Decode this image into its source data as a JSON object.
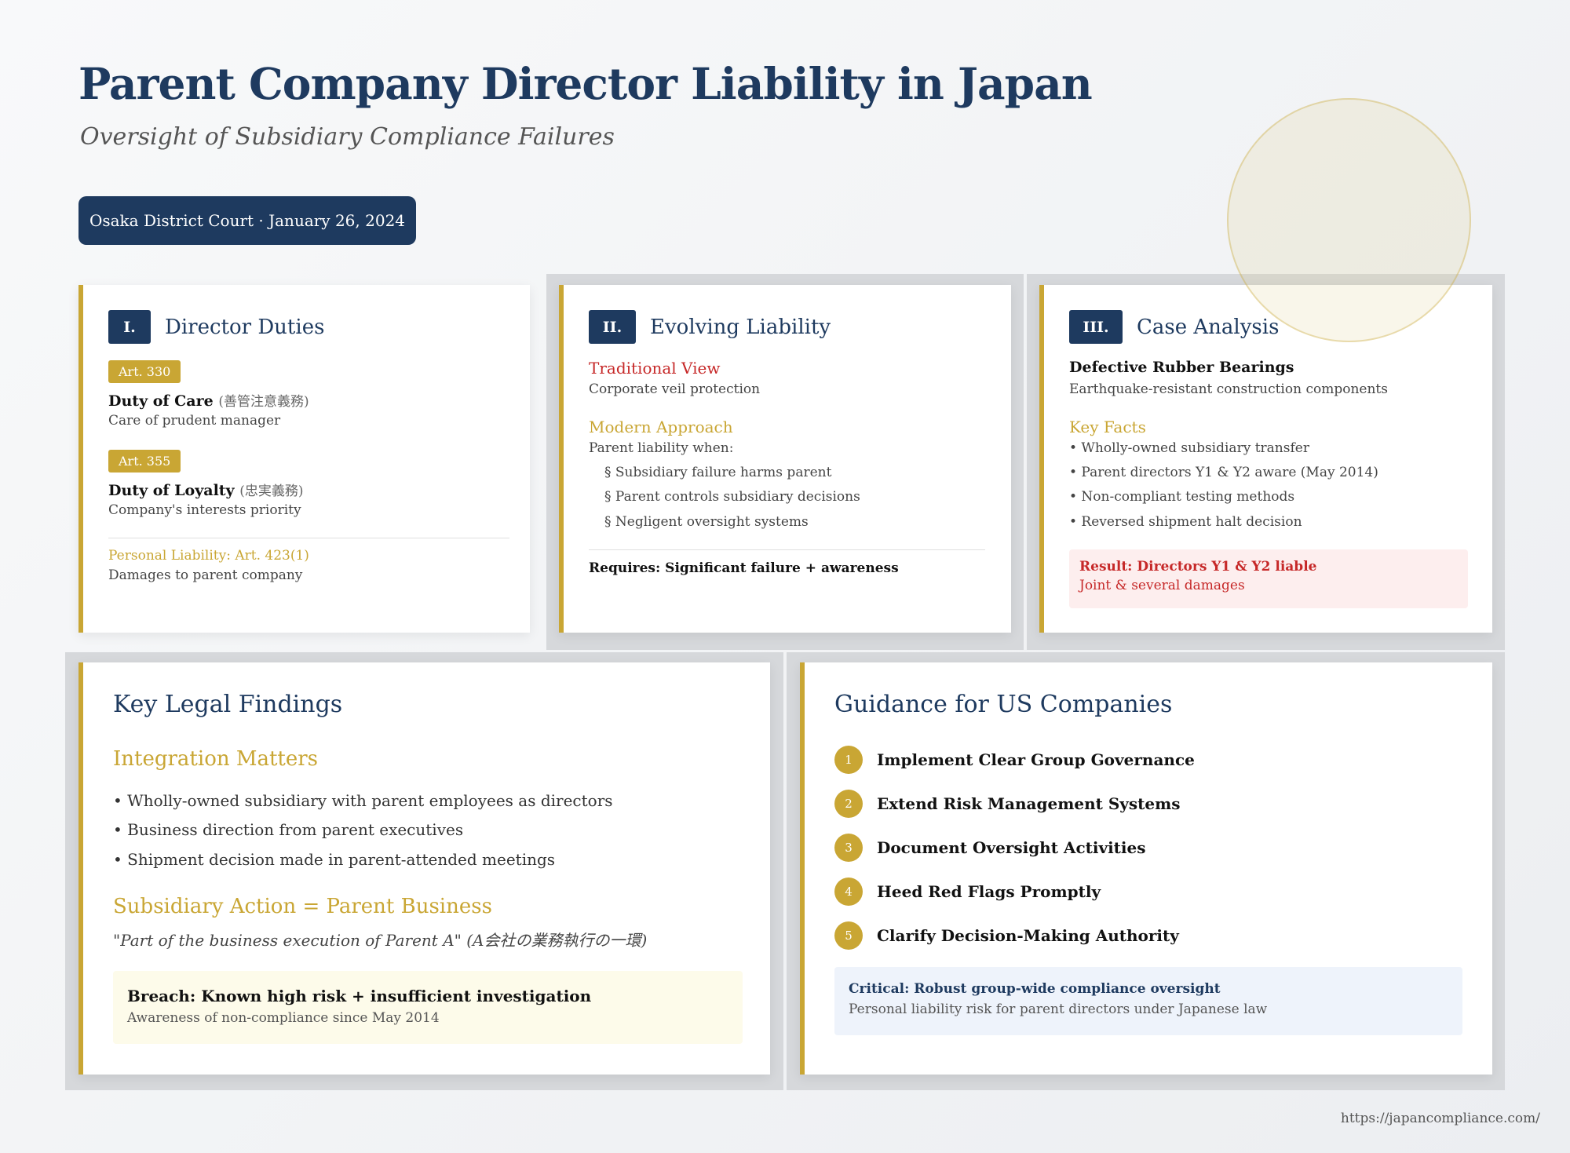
{
  "header": {
    "title": "Parent Company Director Liability in Japan",
    "subtitle": "Oversight of Subsidiary Compliance Failures",
    "court_badge": "Osaka District Court · January 26, 2024"
  },
  "duties": {
    "numeral": "I.",
    "title": "Director Duties",
    "items": [
      {
        "article": "Art. 330",
        "name": "Duty of Care",
        "jp": "(善管注意義務)",
        "desc": "Care of prudent manager"
      },
      {
        "article": "Art. 355",
        "name": "Duty of Loyalty",
        "jp": "(忠実義務)",
        "desc": "Company's interests priority"
      }
    ],
    "personal_liability": "Personal Liability: Art. 423(1)",
    "personal_liability_desc": "Damages to parent company"
  },
  "evolving": {
    "numeral": "II.",
    "title": "Evolving Liability",
    "traditional_heading": "Traditional View",
    "traditional_desc": "Corporate veil protection",
    "modern_heading": "Modern Approach",
    "modern_intro": "Parent liability when:",
    "conditions": [
      "§ Subsidiary failure harms parent",
      "§ Parent controls subsidiary decisions",
      "§ Negligent oversight systems"
    ],
    "requires": "Requires: Significant failure + awareness"
  },
  "case": {
    "numeral": "III.",
    "title": "Case Analysis",
    "product": "Defective Rubber Bearings",
    "product_desc": "Earthquake-resistant construction components",
    "facts_heading": "Key Facts",
    "facts": [
      "• Wholly-owned subsidiary transfer",
      "• Parent directors Y1 & Y2 aware (May 2014)",
      "• Non-compliant testing methods",
      "• Reversed shipment halt decision"
    ],
    "result_title": "Result: Directors Y1 & Y2 liable",
    "result_desc": "Joint & several damages"
  },
  "findings": {
    "title": "Key Legal Findings",
    "integration_heading": "Integration Matters",
    "bullets": [
      "• Wholly-owned subsidiary with parent employees as directors",
      "• Business direction from parent executives",
      "• Shipment decision made in parent-attended meetings"
    ],
    "equation_heading": "Subsidiary Action = Parent Business",
    "quote": "\"Part of the business execution of Parent A\" (A会社の業務執行の一環)",
    "breach_title": "Breach: Known high risk + insufficient investigation",
    "breach_desc": "Awareness of non-compliance since May 2014"
  },
  "guidance": {
    "title": "Guidance for US Companies",
    "items": [
      {
        "num": "1",
        "label": "Implement Clear Group Governance"
      },
      {
        "num": "2",
        "label": "Extend Risk Management Systems"
      },
      {
        "num": "3",
        "label": "Document Oversight Activities"
      },
      {
        "num": "4",
        "label": "Heed Red Flags Promptly"
      },
      {
        "num": "5",
        "label": "Clarify Decision-Making Authority"
      }
    ],
    "critical_title": "Critical: Robust group-wide compliance oversight",
    "critical_desc": "Personal liability risk for parent directors under Japanese law"
  },
  "footer": {
    "url": "https://japancompliance.com/"
  },
  "colors": {
    "navy": "#1e3a5f",
    "gold": "#c9a634",
    "red": "#c62828",
    "frame_gray": "#d6d8db"
  }
}
